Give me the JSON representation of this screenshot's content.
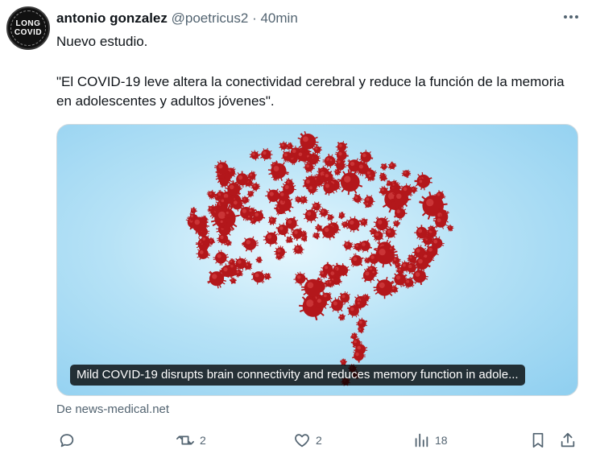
{
  "author": {
    "name": "antonio gonzalez",
    "handle": "@poetricus2",
    "separator": "·",
    "time": "40min",
    "avatar_text": [
      "LONG",
      "COVID"
    ]
  },
  "tweet": {
    "line1": "Nuevo estudio.",
    "line2": "\"El COVID-19 leve altera la conectividad cerebral y reduce la función de la memoria en adolescentes y adultos jóvenes\"."
  },
  "card": {
    "image": "brain-made-of-virus-particles",
    "caption": "Mild COVID-19 disrupts brain connectivity and reduces memory function in adole...",
    "source": "De news-medical.net"
  },
  "actions": {
    "reply": "",
    "retweet": "2",
    "like": "2",
    "views": "18"
  },
  "colors": {
    "text": "#0f1419",
    "muted": "#536471",
    "virus": "#b3171b",
    "card_bg": "#a9dcf3"
  }
}
